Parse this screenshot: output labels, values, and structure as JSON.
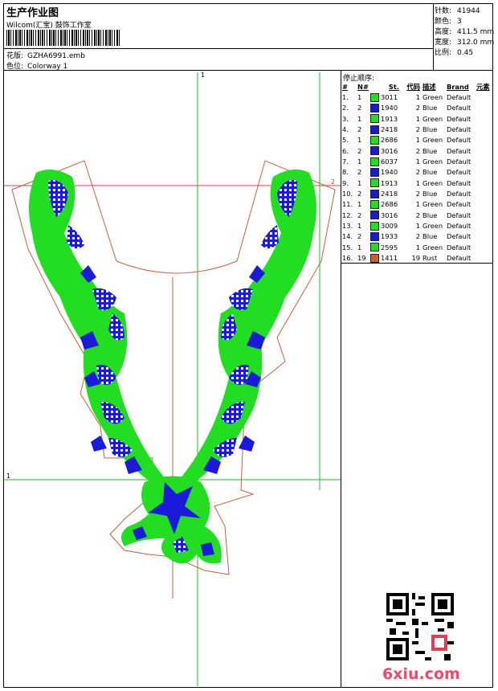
{
  "header": {
    "title": "生产作业图",
    "company": "Wilcom(汇宝) 鼓饰工作室",
    "design_label": "花版:",
    "design_value": "GZHA6991.emb",
    "colorway_label": "色位:",
    "colorway_value": "Colorway 1"
  },
  "stats": [
    {
      "label": "针数:",
      "value": "41944"
    },
    {
      "label": "颜色:",
      "value": "3"
    },
    {
      "label": "高度:",
      "value": "411.5 mm"
    },
    {
      "label": "宽度:",
      "value": "312.0 mm"
    },
    {
      "label": "比例:",
      "value": "0.45"
    }
  ],
  "stop_sequence": {
    "title": "停止顺序:",
    "headers": [
      "#",
      "N#",
      "St.",
      "代码",
      "描述",
      "Brand",
      "元素"
    ],
    "rows": [
      {
        "idx": "1.",
        "n": "1",
        "color": "#22dd22",
        "code": "3011",
        "st": "1",
        "desc": "Green",
        "brand": "Default"
      },
      {
        "idx": "2.",
        "n": "2",
        "color": "#1a1ad8",
        "code": "1940",
        "st": "2",
        "desc": "Blue",
        "brand": "Default"
      },
      {
        "idx": "3.",
        "n": "1",
        "color": "#22dd22",
        "code": "1913",
        "st": "1",
        "desc": "Green",
        "brand": "Default"
      },
      {
        "idx": "4.",
        "n": "2",
        "color": "#1a1ad8",
        "code": "2418",
        "st": "2",
        "desc": "Blue",
        "brand": "Default"
      },
      {
        "idx": "5.",
        "n": "1",
        "color": "#22dd22",
        "code": "2686",
        "st": "1",
        "desc": "Green",
        "brand": "Default"
      },
      {
        "idx": "6.",
        "n": "2",
        "color": "#1a1ad8",
        "code": "3016",
        "st": "2",
        "desc": "Blue",
        "brand": "Default"
      },
      {
        "idx": "7.",
        "n": "1",
        "color": "#22dd22",
        "code": "6037",
        "st": "1",
        "desc": "Green",
        "brand": "Default"
      },
      {
        "idx": "8.",
        "n": "2",
        "color": "#1a1ad8",
        "code": "1940",
        "st": "2",
        "desc": "Blue",
        "brand": "Default"
      },
      {
        "idx": "9.",
        "n": "1",
        "color": "#22dd22",
        "code": "1913",
        "st": "1",
        "desc": "Green",
        "brand": "Default"
      },
      {
        "idx": "10.",
        "n": "2",
        "color": "#1a1ad8",
        "code": "2418",
        "st": "2",
        "desc": "Blue",
        "brand": "Default"
      },
      {
        "idx": "11.",
        "n": "1",
        "color": "#22dd22",
        "code": "2686",
        "st": "1",
        "desc": "Green",
        "brand": "Default"
      },
      {
        "idx": "12.",
        "n": "2",
        "color": "#1a1ad8",
        "code": "3016",
        "st": "2",
        "desc": "Blue",
        "brand": "Default"
      },
      {
        "idx": "13.",
        "n": "1",
        "color": "#22dd22",
        "code": "3009",
        "st": "1",
        "desc": "Green",
        "brand": "Default"
      },
      {
        "idx": "14.",
        "n": "2",
        "color": "#1a1ad8",
        "code": "1933",
        "st": "2",
        "desc": "Blue",
        "brand": "Default"
      },
      {
        "idx": "15.",
        "n": "1",
        "color": "#22dd22",
        "code": "2595",
        "st": "1",
        "desc": "Green",
        "brand": "Default"
      },
      {
        "idx": "16.",
        "n": "19",
        "color": "#c8642a",
        "code": "1411",
        "st": "19",
        "desc": "Rust",
        "brand": "Default"
      }
    ]
  },
  "guide_marks": {
    "top": "1",
    "left": "1",
    "right": "2"
  },
  "watermark": "6xiu.com",
  "colors": {
    "green": "#22dd22",
    "blue": "#1a1ad8",
    "guide": "#22bb22",
    "outline": "#c06040",
    "redline": "#d04040"
  }
}
